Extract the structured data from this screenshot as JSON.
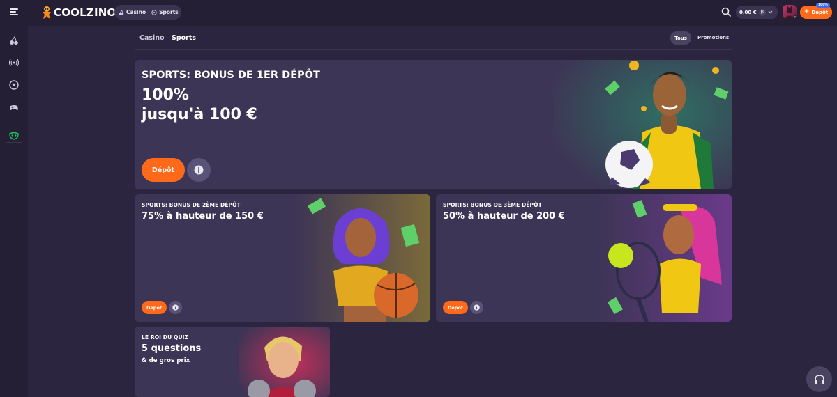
{
  "header": {
    "logo_text": "COOLZINO",
    "switch": [
      {
        "label": "Casino",
        "icon": "cherry-icon"
      },
      {
        "label": "Sports",
        "icon": "ball-icon"
      }
    ],
    "balance": "0.00 €",
    "deposit_label": "Dépôt",
    "deposit_badge": "100%"
  },
  "sidebar": {
    "items": [
      {
        "name": "casino",
        "icon": "cherry-icon"
      },
      {
        "name": "live",
        "icon": "broadcast-icon"
      },
      {
        "name": "sports",
        "icon": "football-icon"
      },
      {
        "name": "games",
        "icon": "gamepad-icon"
      },
      {
        "name": "bonus",
        "icon": "mask-icon"
      }
    ]
  },
  "tabs": [
    {
      "label": "Casino"
    },
    {
      "label": "Sports",
      "active": true
    }
  ],
  "filters": {
    "all": "Tous",
    "promotions": "Promotions"
  },
  "promos": [
    {
      "subtitle": "SPORTS: BONUS DE 1ER DÉPÔT",
      "line1": "100%",
      "line2": "jusqu'à 100 €",
      "button": "Dépôt"
    },
    {
      "subtitle": "SPORTS: BONUS DE 2ÈME DÉPÔT",
      "title": "75% à hauteur de 150 €",
      "button": "Dépôt"
    },
    {
      "subtitle": "SPORTS: BONUS DE 3ÈME DÉPÔT",
      "title": "50% à hauteur de 200 €",
      "button": "Dépôt"
    },
    {
      "subtitle": "LE ROI DU QUIZ",
      "title": "5 questions",
      "tagline": "& de gros prix"
    }
  ],
  "colors": {
    "accent": "#ff6a1a",
    "background": "#2b2540",
    "card": "#3d3555",
    "topbar": "#241f35"
  }
}
